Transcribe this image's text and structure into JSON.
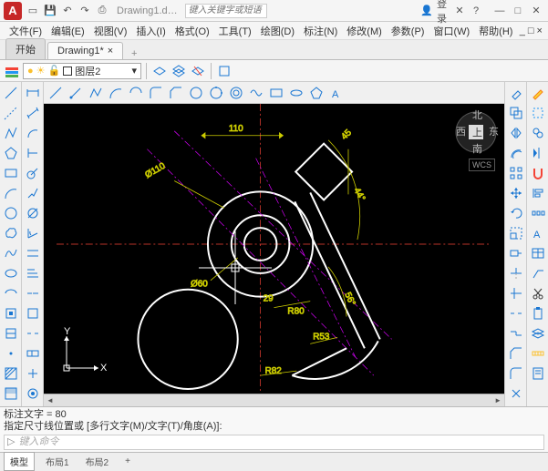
{
  "title": {
    "logo": "A",
    "doc": "Drawing1.d…",
    "search_ph": "键入关键字或短语",
    "login": "登录"
  },
  "menus": [
    "文件(F)",
    "编辑(E)",
    "视图(V)",
    "插入(I)",
    "格式(O)",
    "工具(T)",
    "绘图(D)",
    "标注(N)",
    "修改(M)",
    "参数(P)",
    "窗口(W)",
    "帮助(H)"
  ],
  "menu_right": "_ □ ×",
  "tabs": {
    "start": "开始",
    "doc": "Drawing1*",
    "close": "×",
    "add": "+"
  },
  "layer": {
    "name": "图层2"
  },
  "canvas": {
    "nav": {
      "n": "北",
      "s": "南",
      "e": "东",
      "w": "西",
      "c": "上"
    },
    "wcs": "WCS",
    "ucs": {
      "x": "X",
      "y": "Y"
    },
    "dims": {
      "d110": "Ø110",
      "d60": "Ø60",
      "l110": "110",
      "a44": "44°",
      "v45": "45",
      "r80": "R80",
      "r53": "R53",
      "r82": "R82",
      "a29": "29",
      "a56": "56°"
    }
  },
  "cmd": {
    "l1": "标注文字 = 80",
    "l2": "指定尺寸线位置或 [多行文字(M)/文字(T)/角度(A)]:",
    "icon": "▷",
    "ph": "键入命令"
  },
  "status": {
    "model": "模型",
    "layout1": "布局1",
    "layout2": "布局2"
  }
}
